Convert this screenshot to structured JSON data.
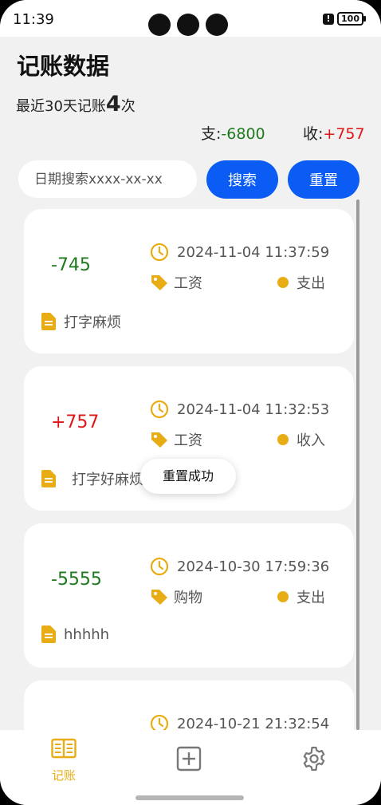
{
  "status_bar": {
    "time": "11:39",
    "battery": "100",
    "alert": "!"
  },
  "header": {
    "title": "记账数据",
    "summary_prefix": "最近30天记账",
    "summary_count": "4",
    "summary_suffix": "次",
    "expense_label": "支:",
    "expense_value": "-6800",
    "income_label": "收:",
    "income_value": "+757"
  },
  "search": {
    "placeholder": "日期搜索xxxx-xx-xx",
    "search_label": "搜索",
    "reset_label": "重置"
  },
  "records": [
    {
      "amount": "-745",
      "type": "expense",
      "datetime": "2024-11-04 11:37:59",
      "category": "工资",
      "direction": "支出",
      "note": "打字麻烦"
    },
    {
      "amount": "+757",
      "type": "income",
      "datetime": "2024-11-04 11:32:53",
      "category": "工资",
      "direction": "收入",
      "note": "打字好麻烦"
    },
    {
      "amount": "-5555",
      "type": "expense",
      "datetime": "2024-10-30 17:59:36",
      "category": "购物",
      "direction": "支出",
      "note": "hhhhh"
    },
    {
      "amount": "",
      "type": "expense",
      "datetime": "2024-10-21 21:32:54",
      "category": "",
      "direction": "",
      "note": ""
    }
  ],
  "toast": {
    "message": "重置成功"
  },
  "tabbar": {
    "items": [
      {
        "label": "记账",
        "icon": "book-icon",
        "active": true
      },
      {
        "label": "",
        "icon": "add-icon",
        "active": false
      },
      {
        "label": "",
        "icon": "gear-icon",
        "active": false
      }
    ]
  },
  "colors": {
    "accent": "#0a5cf5",
    "expense": "#1f7a1f",
    "income": "#e01515",
    "icon_yellow": "#e8ad14"
  }
}
